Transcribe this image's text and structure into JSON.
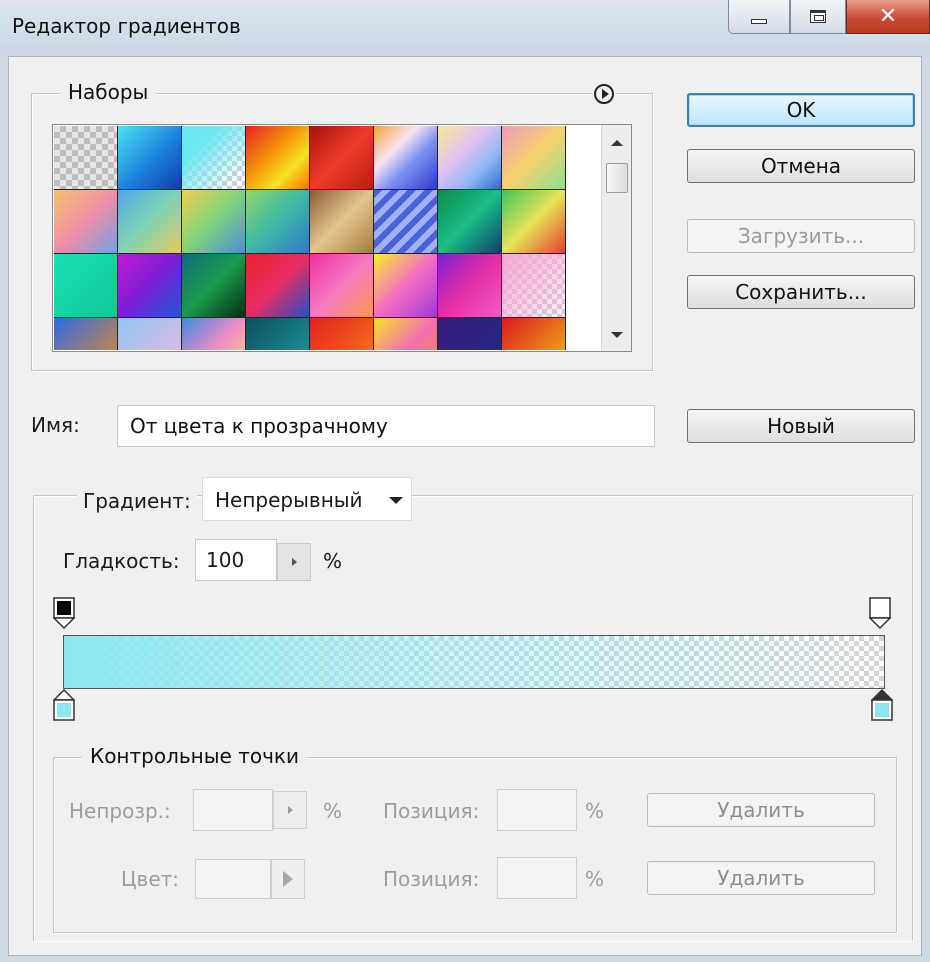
{
  "window": {
    "title": "Редактор градиентов",
    "controls": [
      "minimize",
      "maximize",
      "close"
    ]
  },
  "presets": {
    "label": "Наборы",
    "menu_icon": "circle-arrow-right-icon",
    "swatch_rows": 4,
    "swatch_cols": 8,
    "swatches": [
      "checker-gray",
      "blue-azure",
      "cyan-transparent",
      "red-orange-yellow",
      "red-deep",
      "blue-violet-orange",
      "yellow-violet-blue",
      "pink-orange-green",
      "orange-pink-blue",
      "blue-green-gold",
      "gold-green-blue",
      "green-blue-teal",
      "brown-gold-copper",
      "blue-purple-stripes",
      "green-dark-blue",
      "green-yellow-red",
      "teal-green",
      "purple-magenta-blue",
      "dark-teal-green",
      "red-pink-blue",
      "magenta-pink-orange",
      "yellow-pink-purple",
      "purple-pink-magenta",
      "pink-checker",
      "blue-orange",
      "blue-pink-soft",
      "blue-pink-yellow",
      "dark-teal-blue",
      "red-orange",
      "yellow-pink-orange",
      "purple-blue-dark",
      "red-yellow"
    ]
  },
  "buttons": {
    "ok": "OK",
    "cancel": "Отмена",
    "load": "Загрузить...",
    "save": "Сохранить...",
    "new": "Новый"
  },
  "name": {
    "label": "Имя:",
    "value": "От цвета к прозрачному"
  },
  "gradient": {
    "type_label": "Градиент:",
    "type_value": "Непрерывный",
    "smoothness_label": "Гладкость:",
    "smoothness_value": "100",
    "smoothness_unit": "%",
    "start_color": "#8ce8f0",
    "opacity_stops": [
      {
        "opacity": 100,
        "location": 0,
        "color": "#000000"
      },
      {
        "opacity": 0,
        "location": 100,
        "color": "#ffffff"
      }
    ],
    "color_stops": [
      {
        "location": 0,
        "color": "#8ce8f0"
      },
      {
        "location": 100,
        "color": "#8ce8f0"
      }
    ]
  },
  "control_points": {
    "label": "Контрольные точки",
    "opacity_label": "Непрозр.:",
    "opacity_unit": "%",
    "position_label_1": "Позиция:",
    "position_unit_1": "%",
    "delete_1": "Удалить",
    "color_label": "Цвет:",
    "position_label_2": "Позиция:",
    "position_unit_2": "%",
    "delete_2": "Удалить"
  }
}
